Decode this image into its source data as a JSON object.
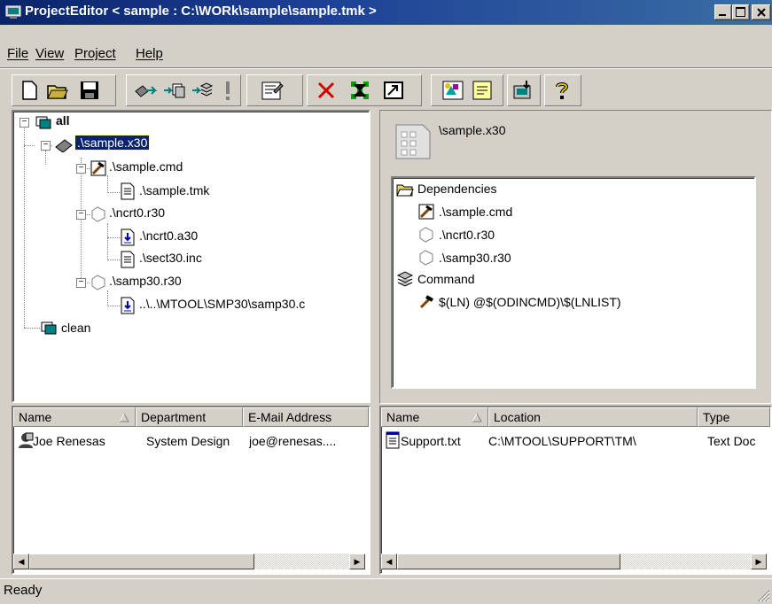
{
  "window": {
    "title": "ProjectEditor < sample : C:\\WORk\\sample\\sample.tmk >"
  },
  "menu": [
    "File",
    "View",
    "Project",
    "Help"
  ],
  "toolbar": {
    "buttons": [
      "new-icon",
      "open-icon",
      "save-icon",
      "build-icon",
      "build-all-icon",
      "rebuild-icon",
      "stop-icon",
      "properties-icon",
      "delete-icon",
      "tree-icon",
      "view-icon",
      "tool-icon",
      "note-icon",
      "download-icon",
      "help-icon"
    ]
  },
  "tree": {
    "all": "all",
    "sample_x30": ".\\sample.x30",
    "sample_cmd": ".\\sample.cmd",
    "sample_tmk": ".\\sample.tmk",
    "ncrt0_r30": ".\\ncrt0.r30",
    "ncrt0_a30": ".\\ncrt0.a30",
    "sect30_inc": ".\\sect30.inc",
    "samp30_r30": ".\\samp30.r30",
    "samp30_c": "..\\..\\MTOOL\\SMP30\\samp30.c",
    "clean": "clean"
  },
  "detail": {
    "title": "\\sample.x30",
    "dependencies_label": "Dependencies",
    "dep_cmd": ".\\sample.cmd",
    "dep_ncrt0": ".\\ncrt0.r30",
    "dep_samp30": ".\\samp30.r30",
    "command_label": "Command",
    "command": "$(LN) @$(ODINCMD)\\$(LNLIST)"
  },
  "users": {
    "headers": [
      "Name",
      "Department",
      "E-Mail Address"
    ],
    "rows": [
      {
        "name": "Joe Renesas",
        "department": "System Design",
        "email": "joe@renesas...."
      }
    ]
  },
  "files": {
    "headers": [
      "Name",
      "Location",
      "Type"
    ],
    "rows": [
      {
        "name": "Support.txt",
        "location": "C:\\MTOOL\\SUPPORT\\TM\\",
        "type": "Text Doc"
      }
    ]
  },
  "status": "Ready",
  "colors": {
    "titlebar": "#0a246a",
    "face": "#d4d0c8",
    "selection": "#0a246a"
  }
}
